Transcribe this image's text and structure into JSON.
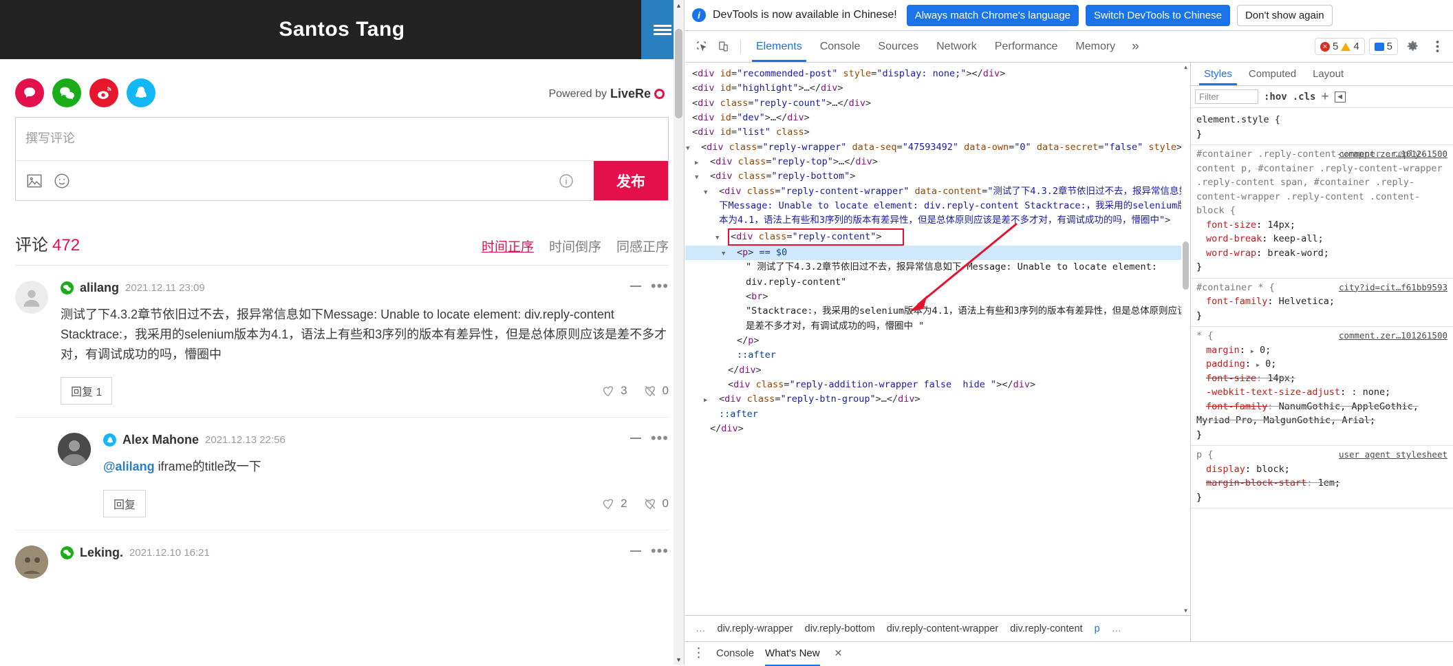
{
  "page": {
    "site_title": "Santos Tang",
    "menu_icon": "hamburger-icon",
    "social": [
      {
        "name": "livere-login",
        "label": "LiveRe"
      },
      {
        "name": "wechat-login",
        "label": "WeChat"
      },
      {
        "name": "weibo-login",
        "label": "Weibo"
      },
      {
        "name": "qq-login",
        "label": "QQ"
      }
    ],
    "powered_prefix": "Powered by",
    "powered_brand": "LiveRe",
    "editor": {
      "placeholder": "撰写评论",
      "image_icon": "image-icon",
      "emoji_icon": "emoji-icon",
      "info_icon": "info-icon",
      "publish_label": "发布"
    },
    "comments_header": {
      "label": "评论",
      "count": "472"
    },
    "sorts": [
      {
        "label": "时间正序",
        "active": true
      },
      {
        "label": "时间倒序",
        "active": false
      },
      {
        "label": "同感正序",
        "active": false
      }
    ],
    "comments": [
      {
        "name": "alilang",
        "date": "2021.12.11 23:09",
        "badge": "wechat",
        "text_line1": "测试了下4.3.2章节依旧过不去，报异常信息如下Message: Unable to locate element: div.reply-content",
        "text_line2": "Stacktrace:，我采用的selenium版本为4.1，语法上有些和3序列的版本有差异性，但是总体原则应该是差不多才对，有调试成功的吗，懵圈中",
        "reply_label": "回复 1",
        "likes": "3",
        "dislikes": "0"
      },
      {
        "name": "Alex Mahone",
        "date": "2021.12.13 22:56",
        "badge": "qq",
        "mention": "@alilang",
        "text_line1": "iframe的title改一下",
        "reply_label": "回复",
        "likes": "2",
        "dislikes": "0"
      },
      {
        "name": "Leking.",
        "date": "2021.12.10 16:21",
        "badge": "wechat"
      }
    ]
  },
  "devtools": {
    "banner": {
      "message": "DevTools is now available in Chinese!",
      "btn_always": "Always match Chrome's language",
      "btn_switch": "Switch DevTools to Chinese",
      "btn_dismiss": "Don't show again"
    },
    "toolbar": {
      "inspect_icon": "inspect-element-icon",
      "device_icon": "device-toolbar-icon",
      "tabs": [
        {
          "label": "Elements",
          "active": true
        },
        {
          "label": "Console",
          "active": false
        },
        {
          "label": "Sources",
          "active": false
        },
        {
          "label": "Network",
          "active": false
        },
        {
          "label": "Performance",
          "active": false
        },
        {
          "label": "Memory",
          "active": false
        }
      ],
      "more": "»",
      "errors": "5",
      "warnings": "4",
      "messages": "5",
      "settings_icon": "gear-icon",
      "kebab_icon": "kebab-menu-icon"
    },
    "dom": [
      {
        "indent": 0,
        "tri": "",
        "html": "&lt;<span class=\"tag\">div</span> <span class=\"attr\">id</span>=<span class=\"val\">\"recommended-post\"</span> <span class=\"attr\">style</span>=<span class=\"val\">\"display: none;\"</span>&gt;&lt;/<span class=\"tag\">div</span>&gt;"
      },
      {
        "indent": 0,
        "tri": "▶",
        "html": "&lt;<span class=\"tag\">div</span> <span class=\"attr\">id</span>=<span class=\"val\">\"highlight\"</span>&gt;…&lt;/<span class=\"tag\">div</span>&gt;"
      },
      {
        "indent": 0,
        "tri": "▶",
        "html": "&lt;<span class=\"tag\">div</span> <span class=\"attr\">class</span>=<span class=\"val\">\"reply-count\"</span>&gt;…&lt;/<span class=\"tag\">div</span>&gt;"
      },
      {
        "indent": 0,
        "tri": "▶",
        "html": "&lt;<span class=\"tag\">div</span> <span class=\"attr\">id</span>=<span class=\"val\">\"dev\"</span>&gt;…&lt;/<span class=\"tag\">div</span>&gt;"
      },
      {
        "indent": 0,
        "tri": "▼",
        "html": "&lt;<span class=\"tag\">div</span> <span class=\"attr\">id</span>=<span class=\"val\">\"list\"</span> <span class=\"attr\">class</span>&gt;"
      },
      {
        "indent": 1,
        "tri": "▼",
        "html": "&lt;<span class=\"tag\">div</span> <span class=\"attr\">class</span>=<span class=\"val\">\"reply-wrapper\"</span> <span class=\"attr\">data-seq</span>=<span class=\"val\">\"47593492\"</span> <span class=\"attr\">data-own</span>=<span class=\"val\">\"0\"</span> <span class=\"attr\">data-secret</span>=<span class=\"val\">\"false\"</span> <span class=\"attr\">style</span>&gt;"
      },
      {
        "indent": 2,
        "tri": "▶",
        "html": "&lt;<span class=\"tag\">div</span> <span class=\"attr\">class</span>=<span class=\"val\">\"reply-top\"</span>&gt;…&lt;/<span class=\"tag\">div</span>&gt;"
      },
      {
        "indent": 2,
        "tri": "▼",
        "html": "&lt;<span class=\"tag\">div</span> <span class=\"attr\">class</span>=<span class=\"val\">\"reply-bottom\"</span>&gt;"
      },
      {
        "indent": 3,
        "tri": "▼",
        "html": "&lt;<span class=\"tag\">div</span> <span class=\"attr\">class</span>=<span class=\"val\">\"reply-content-wrapper\"</span> <span class=\"attr\">data-content</span>=<span class=\"val\">\"测试了下4.3.2章节依旧过不去，报异常信息如下Message: Unable to locate element: div.reply-content Stacktrace:，我采用的selenium版本为4.1，语法上有些和3序列的版本有差异性，但是总体原则应该是差不多才对，有调试成功的吗，懵圈中\"</span>&gt;"
      },
      {
        "indent": 4,
        "tri": "▼",
        "html": "&lt;<span class=\"tag\">div</span> <span class=\"attr\">class</span>=<span class=\"val\">\"reply-content\"</span>&gt;",
        "boxed": true
      },
      {
        "indent": 5,
        "tri": "▼",
        "html": "&lt;<span class=\"pk\">p</span>&gt; <span class=\"ps\">== $0</span>",
        "selected": true
      },
      {
        "indent": 6,
        "tri": "",
        "html": "<span class=\"txt\">\" 测试了下4.3.2章节依旧过不去，报异常信息如下 Message: Unable to locate element: div.reply-content\"</span>"
      },
      {
        "indent": 6,
        "tri": "",
        "html": "&lt;<span class=\"tag\">br</span>&gt;"
      },
      {
        "indent": 6,
        "tri": "",
        "html": "<span class=\"txt\">\"Stacktrace:，我采用的selenium版本为4.1，语法上有些和3序列的版本有差异性，但是总体原则应该是差不多才对，有调试成功的吗，懵圈中 \"</span>"
      },
      {
        "indent": 5,
        "tri": "",
        "html": "&lt;/<span class=\"pk\">p</span>&gt;"
      },
      {
        "indent": 5,
        "tri": "",
        "html": "<span class=\"after\">::after</span>"
      },
      {
        "indent": 4,
        "tri": "",
        "html": "&lt;/<span class=\"tag\">div</span>&gt;"
      },
      {
        "indent": 4,
        "tri": "",
        "html": "&lt;<span class=\"tag\">div</span> <span class=\"attr\">class</span>=<span class=\"val\">\"reply-addition-wrapper false  hide \"</span>&gt;&lt;/<span class=\"tag\">div</span>&gt;"
      },
      {
        "indent": 3,
        "tri": "▶",
        "html": "&lt;<span class=\"tag\">div</span> <span class=\"attr\">class</span>=<span class=\"val\">\"reply-btn-group\"</span>&gt;…&lt;/<span class=\"tag\">div</span>&gt;"
      },
      {
        "indent": 3,
        "tri": "",
        "html": "<span class=\"after\">::after</span>"
      },
      {
        "indent": 2,
        "tri": "",
        "html": "&lt;/<span class=\"tag\">div</span>&gt;"
      }
    ],
    "breadcrumbs": [
      {
        "label": "…",
        "active": false
      },
      {
        "label": "div.reply-wrapper",
        "active": false
      },
      {
        "label": "div.reply-bottom",
        "active": false
      },
      {
        "label": "div.reply-content-wrapper",
        "active": false
      },
      {
        "label": "div.reply-content",
        "active": false
      },
      {
        "label": "p",
        "active": true
      },
      {
        "label": "…",
        "active": false
      }
    ],
    "styles": {
      "tabs": [
        {
          "label": "Styles",
          "active": true
        },
        {
          "label": "Computed",
          "active": false
        },
        {
          "label": "Layout",
          "active": false
        }
      ],
      "filter_placeholder": "Filter",
      "hov": ":hov",
      "cls": ".cls",
      "plus": "+",
      "rules": [
        {
          "selector_html": "element.style {",
          "close": "}",
          "source": "",
          "props": []
        },
        {
          "selector_html": "#container .reply-content-wrapper .reply-content p, #container .reply-content-wrapper .reply-content span, #container .reply-content-wrapper .reply-content .content-block {",
          "close": "}",
          "source": "comment.zer…101261500",
          "props": [
            {
              "name": "font-size",
              "value": "14px;"
            },
            {
              "name": "word-break",
              "value": "keep-all;"
            },
            {
              "name": "word-wrap",
              "value": "break-word;"
            }
          ]
        },
        {
          "selector_html": "#container * {",
          "close": "}",
          "source": "city?id=cit…f61bb9593",
          "props": [
            {
              "name": "font-family",
              "value": "Helvetica;"
            }
          ]
        },
        {
          "selector_html": "* {",
          "close": "}",
          "source": "comment.zer…101261500",
          "props": [
            {
              "name": "margin",
              "value": "0;",
              "arrow": true
            },
            {
              "name": "padding",
              "value": "0;",
              "arrow": true
            },
            {
              "name": "font-size",
              "value": "14px;",
              "strike": true
            },
            {
              "name": "-webkit-text-size-adjust",
              "value": ": none;"
            },
            {
              "name": "font-family",
              "value": "NanumGothic, AppleGothic, Myriad Pro, MalgunGothic, Arial;",
              "strike": true
            }
          ]
        },
        {
          "selector_html": "p {",
          "close": "}",
          "source": "user agent stylesheet",
          "props": [
            {
              "name": "display",
              "value": "block;"
            },
            {
              "name": "margin-block-start",
              "value": "1em;",
              "strike": true
            }
          ]
        }
      ]
    },
    "bottom": {
      "kebab": "kebab-menu-icon",
      "console_label": "Console",
      "whatsnew_label": "What's New",
      "close_icon": "close-icon"
    }
  }
}
